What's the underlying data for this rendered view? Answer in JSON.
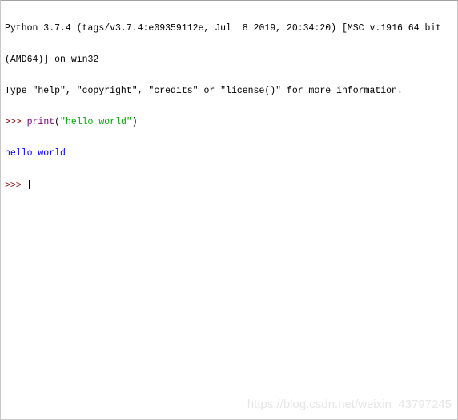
{
  "shell": {
    "banner": [
      "Python 3.7.4 (tags/v3.7.4:e09359112e, Jul  8 2019, 20:34:20) [MSC v.1916 64 bit",
      "(AMD64)] on win32",
      "Type \"help\", \"copyright\", \"credits\" or \"license()\" for more information."
    ],
    "prompt": ">>> ",
    "command": {
      "func": "print",
      "open": "(",
      "arg": "\"hello world\"",
      "close": ")"
    },
    "output": "hello world",
    "colors": {
      "prompt": "#8b0000",
      "builtin": "#800080",
      "string": "#00aa00",
      "output": "#0000ff"
    }
  },
  "watermark": "https://blog.csdn.net/weixin_43797245"
}
